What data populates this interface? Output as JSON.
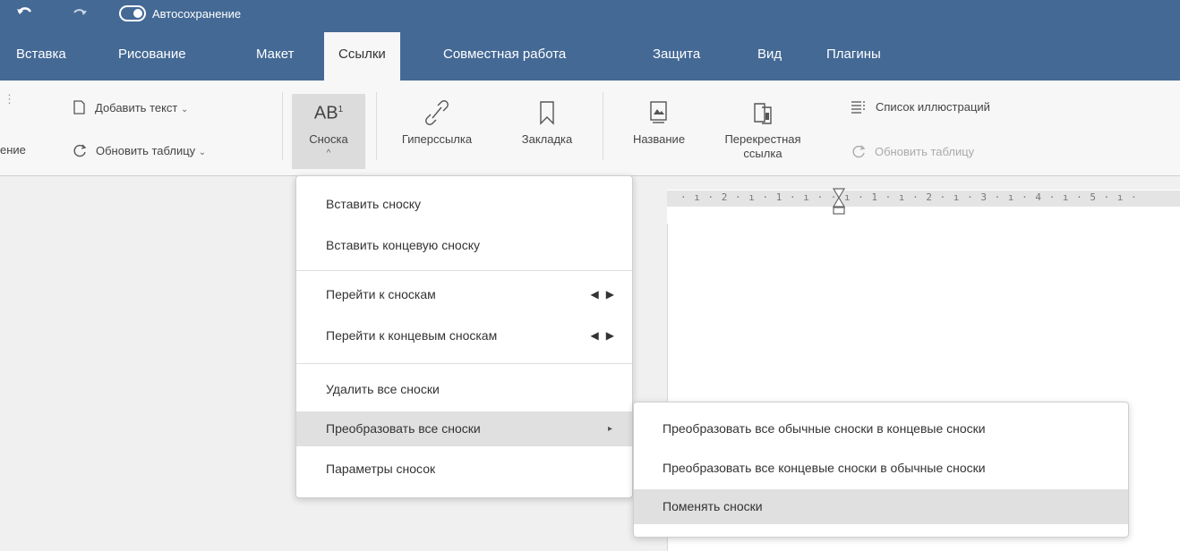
{
  "header": {
    "autosave_label": "Автосохранение",
    "tabs": [
      {
        "label": "Вставка"
      },
      {
        "label": "Рисование"
      },
      {
        "label": "Макет"
      },
      {
        "label": "Ссылки"
      },
      {
        "label": "Совместная работа"
      },
      {
        "label": "Защита"
      },
      {
        "label": "Вид"
      },
      {
        "label": "Плагины"
      }
    ]
  },
  "ribbon": {
    "cut_label": "ение",
    "add_text": "Добавить текст",
    "update_table": "Обновить таблицу",
    "footnote": "Сноска",
    "footnote_icon_text": "AB",
    "footnote_icon_sup": "1",
    "hyperlink": "Гиперссылка",
    "bookmark": "Закладка",
    "caption": "Название",
    "cross_ref_line1": "Перекрестная",
    "cross_ref_line2": "ссылка",
    "figure_list": "Список иллюстраций",
    "update_table_disabled": "Обновить таблицу"
  },
  "ruler": {
    "text": "· ı · 2 · ı · 1 · ı ·     · ı · 1 · ı · 2 · ı · 3 · ı · 4 · ı · 5 · ı ·"
  },
  "footnote_menu": {
    "insert_footnote": "Вставить сноску",
    "insert_endnote": "Вставить концевую сноску",
    "goto_footnotes": "Перейти к сноскам",
    "goto_endnotes": "Перейти к концевым сноскам",
    "delete_all": "Удалить все сноски",
    "convert_all": "Преобразовать все сноски",
    "settings": "Параметры сносок"
  },
  "convert_submenu": {
    "to_endnotes": "Преобразовать все обычные сноски в концевые сноски",
    "to_footnotes": "Преобразовать все концевые сноски в обычные сноски",
    "swap": "Поменять сноски"
  },
  "colors": {
    "header_bg": "#446995",
    "ribbon_bg": "#f7f7f7",
    "highlight": "#e0e0e0"
  }
}
